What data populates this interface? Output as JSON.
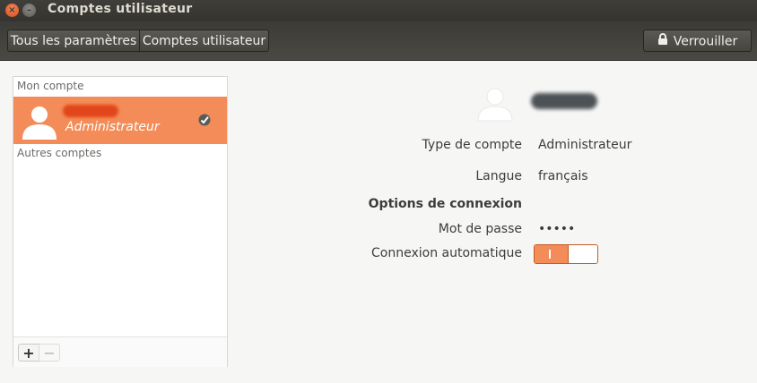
{
  "window": {
    "title": "Comptes utilisateur",
    "close_glyph": "×",
    "min_glyph": "–"
  },
  "toolbar": {
    "breadcrumb": [
      "Tous les paramètres",
      "Comptes utilisateur"
    ],
    "lock_label": "Verrouiller",
    "lock_icon": "lock-icon"
  },
  "sidebar": {
    "my_account_header": "Mon compte",
    "selected_account": {
      "role": "Administrateur",
      "avatar_icon": "user-icon",
      "status_icon": "check-icon"
    },
    "other_accounts_header": "Autres comptes",
    "add_label": "+",
    "remove_label": "−"
  },
  "details": {
    "account_type_label": "Type de compte",
    "account_type_value": "Administrateur",
    "language_label": "Langue",
    "language_value": "français",
    "login_options_header": "Options de connexion",
    "password_label": "Mot de passe",
    "password_value": "•••••",
    "autologin_label": "Connexion automatique",
    "autologin_on": true
  },
  "colors": {
    "accent": "#f38c58",
    "accent_border": "#c65a22",
    "titlebar": "#3c3b37"
  }
}
